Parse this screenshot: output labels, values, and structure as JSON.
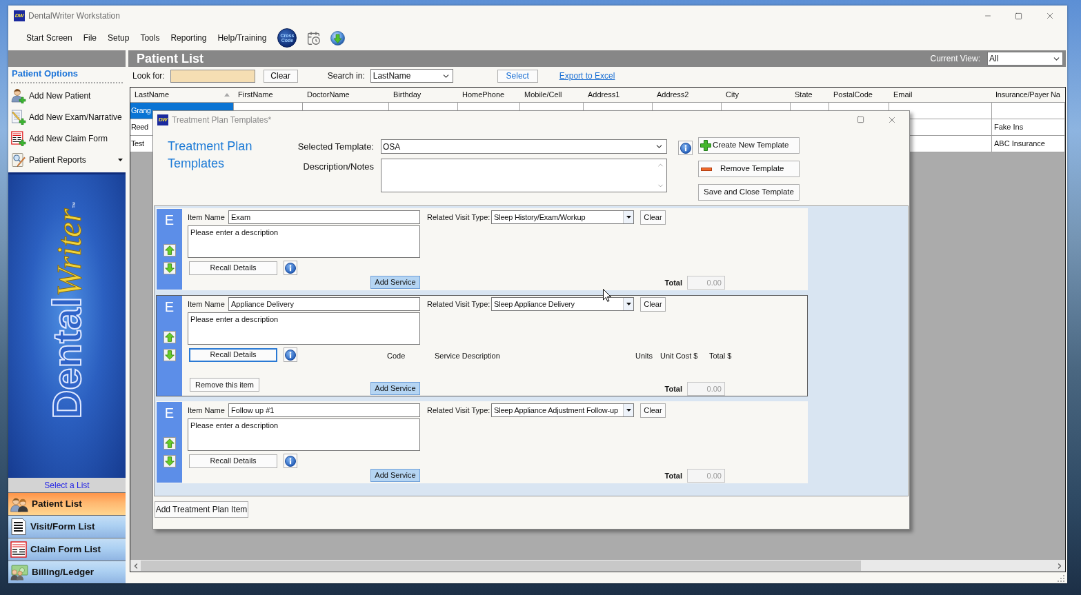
{
  "window": {
    "logo": "DW",
    "title": "DentalWriter Workstation"
  },
  "menu": [
    "Start Screen",
    "File",
    "Setup",
    "Tools",
    "Reporting",
    "Help/Training"
  ],
  "toolbar": {
    "badge": "Cross Code"
  },
  "sidebar": {
    "options_title": "Patient Options",
    "options": [
      {
        "label": "Add New Patient",
        "kind": "link"
      },
      {
        "label": "Add New Exam/Narrative",
        "kind": "link"
      },
      {
        "label": "Add New Claim Form",
        "kind": "link"
      },
      {
        "label": "Patient Reports",
        "kind": "dropdown"
      }
    ],
    "banner": {
      "words": [
        "Dental",
        "Writer"
      ],
      "mark": "™"
    },
    "list_heading": "Select a List",
    "lists": [
      {
        "label": "Patient List",
        "selected": true
      },
      {
        "label": "Visit/Form List",
        "selected": false
      },
      {
        "label": "Claim Form List",
        "selected": false
      },
      {
        "label": "Billing/Ledger",
        "selected": false
      }
    ]
  },
  "patient_list": {
    "title": "Patient List",
    "view_label": "Current View:",
    "view_value": "All",
    "look_for_label": "Look for:",
    "clear_button": "Clear",
    "search_in_label": "Search in:",
    "search_in_value": "LastName",
    "select_button": "Select",
    "export_link": "Export to Excel",
    "table": {
      "columns": [
        {
          "label": "LastName",
          "sorted": true
        },
        {
          "label": "FirstName",
          "sorted": false
        },
        {
          "label": "DoctorName",
          "sorted": false
        },
        {
          "label": "Birthday",
          "sorted": false
        },
        {
          "label": "HomePhone",
          "sorted": false
        },
        {
          "label": "Mobile/Cell",
          "sorted": false
        },
        {
          "label": "Address1",
          "sorted": false
        },
        {
          "label": "Address2",
          "sorted": false
        },
        {
          "label": "City",
          "sorted": false
        },
        {
          "label": "State",
          "sorted": false
        },
        {
          "label": "PostalCode",
          "sorted": false
        },
        {
          "label": "Email",
          "sorted": false
        },
        {
          "label": "Insurance/Payer Na",
          "sorted": false
        }
      ],
      "rows": [
        {
          "selected": true,
          "last_name": "Grang"
        },
        {
          "selected": false,
          "last_name": "Reed",
          "insurance": "Fake Ins"
        },
        {
          "selected": false,
          "last_name": "Test",
          "insurance": "ABC Insurance"
        }
      ]
    }
  },
  "dialog": {
    "logo": "DW",
    "title": "Treatment Plan Templates*",
    "heading": "Treatment Plan Templates",
    "template_label": "Selected Template:",
    "template_value": "OSA",
    "notes_label": "Description/Notes",
    "buttons": [
      {
        "label": "Create New Template",
        "kind": "add"
      },
      {
        "label": "Remove Template",
        "kind": "remove"
      },
      {
        "label": "Save and Close Template",
        "kind": "plain"
      }
    ],
    "items": [
      {
        "badge": "E",
        "selected": false,
        "name_label": "Item Name",
        "name": "Exam",
        "description": "Please enter a description",
        "visit_type_label": "Related Visit Type:",
        "visit_type": "Sleep History/Exam/Workup",
        "clear_button": "Clear",
        "recall_button": "Recall Details",
        "add_service_button": "Add Service",
        "total_label": "Total",
        "total": "0.00"
      },
      {
        "badge": "E",
        "selected": true,
        "name_label": "Item Name",
        "name": "Appliance Delivery",
        "description": "Please enter a description",
        "visit_type_label": "Related Visit Type:",
        "visit_type": "Sleep Appliance Delivery",
        "clear_button": "Clear",
        "recall_button": "Recall Details",
        "service_columns": [
          "Code",
          "Service Description",
          "Units",
          "Unit Cost $",
          "Total $"
        ],
        "remove_button": "Remove this item",
        "add_service_button": "Add Service",
        "total_label": "Total",
        "total": "0.00"
      },
      {
        "badge": "E",
        "selected": false,
        "name_label": "Item Name",
        "name": "Follow up #1",
        "description": "Please enter a description",
        "visit_type_label": "Related Visit Type:",
        "visit_type": "Sleep Appliance Adjustment Follow-up",
        "clear_button": "Clear",
        "recall_button": "Recall Details",
        "add_service_button": "Add Service",
        "total_label": "Total",
        "total": "0.00"
      }
    ],
    "add_item_button": "Add Treatment Plan Item"
  }
}
